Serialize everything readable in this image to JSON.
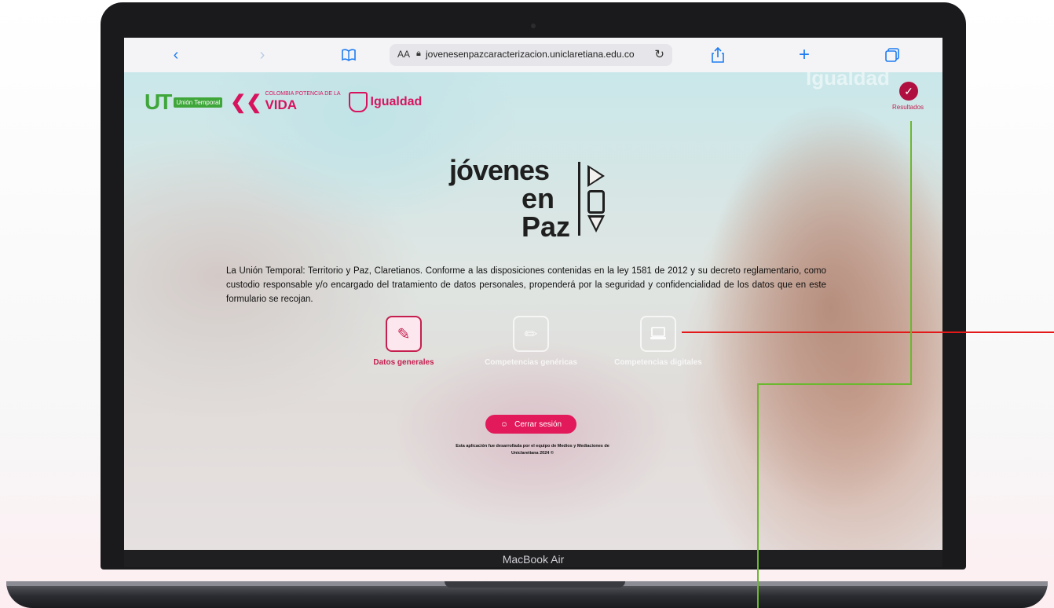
{
  "browser": {
    "text_size_label": "AA",
    "url": "jovenesenpazcaracterizacion.uniclaretiana.edu.co"
  },
  "logos": {
    "ut_main": "UT",
    "ut_sub": "Unión Temporal",
    "colombia_lines": "COLOMBIA POTENCIA DE LA",
    "colombia_vida": "VIDA",
    "igualdad": "Igualdad",
    "igualdad_background": "Igualdad"
  },
  "results": {
    "label": "Resultados"
  },
  "brand": {
    "line1": "jóvenes",
    "line2": "en",
    "line3": "Paz"
  },
  "legal_text": "La Unión Temporal: Territorio y Paz, Claretianos. Conforme a las disposiciones contenidas en la ley 1581 de 2012 y su decreto reglamentario, como custodio responsable y/o encargado del tratamiento de datos personales, propenderá por la seguridad y confidencialidad de los datos que en este formulario se recojan.",
  "modules": [
    {
      "label": "Datos generales",
      "icon": "user-edit-icon",
      "state": "active"
    },
    {
      "label": "Competencias genéricas",
      "icon": "pencil-icon",
      "state": "disabled"
    },
    {
      "label": "Competencias digitales",
      "icon": "laptop-icon",
      "state": "disabled"
    }
  ],
  "logout": {
    "label": "Cerrar sesión"
  },
  "footnote": "Esta aplicación fue desarrollada por el equipo de Medios y Mediaciones de Uniclaretiana 2024 ©",
  "device": {
    "label": "MacBook Air"
  },
  "colors": {
    "brand_pink": "#e2195a",
    "active_module": "#c41f4e",
    "annotation_red": "#e31818",
    "annotation_green": "#6bb82f"
  }
}
